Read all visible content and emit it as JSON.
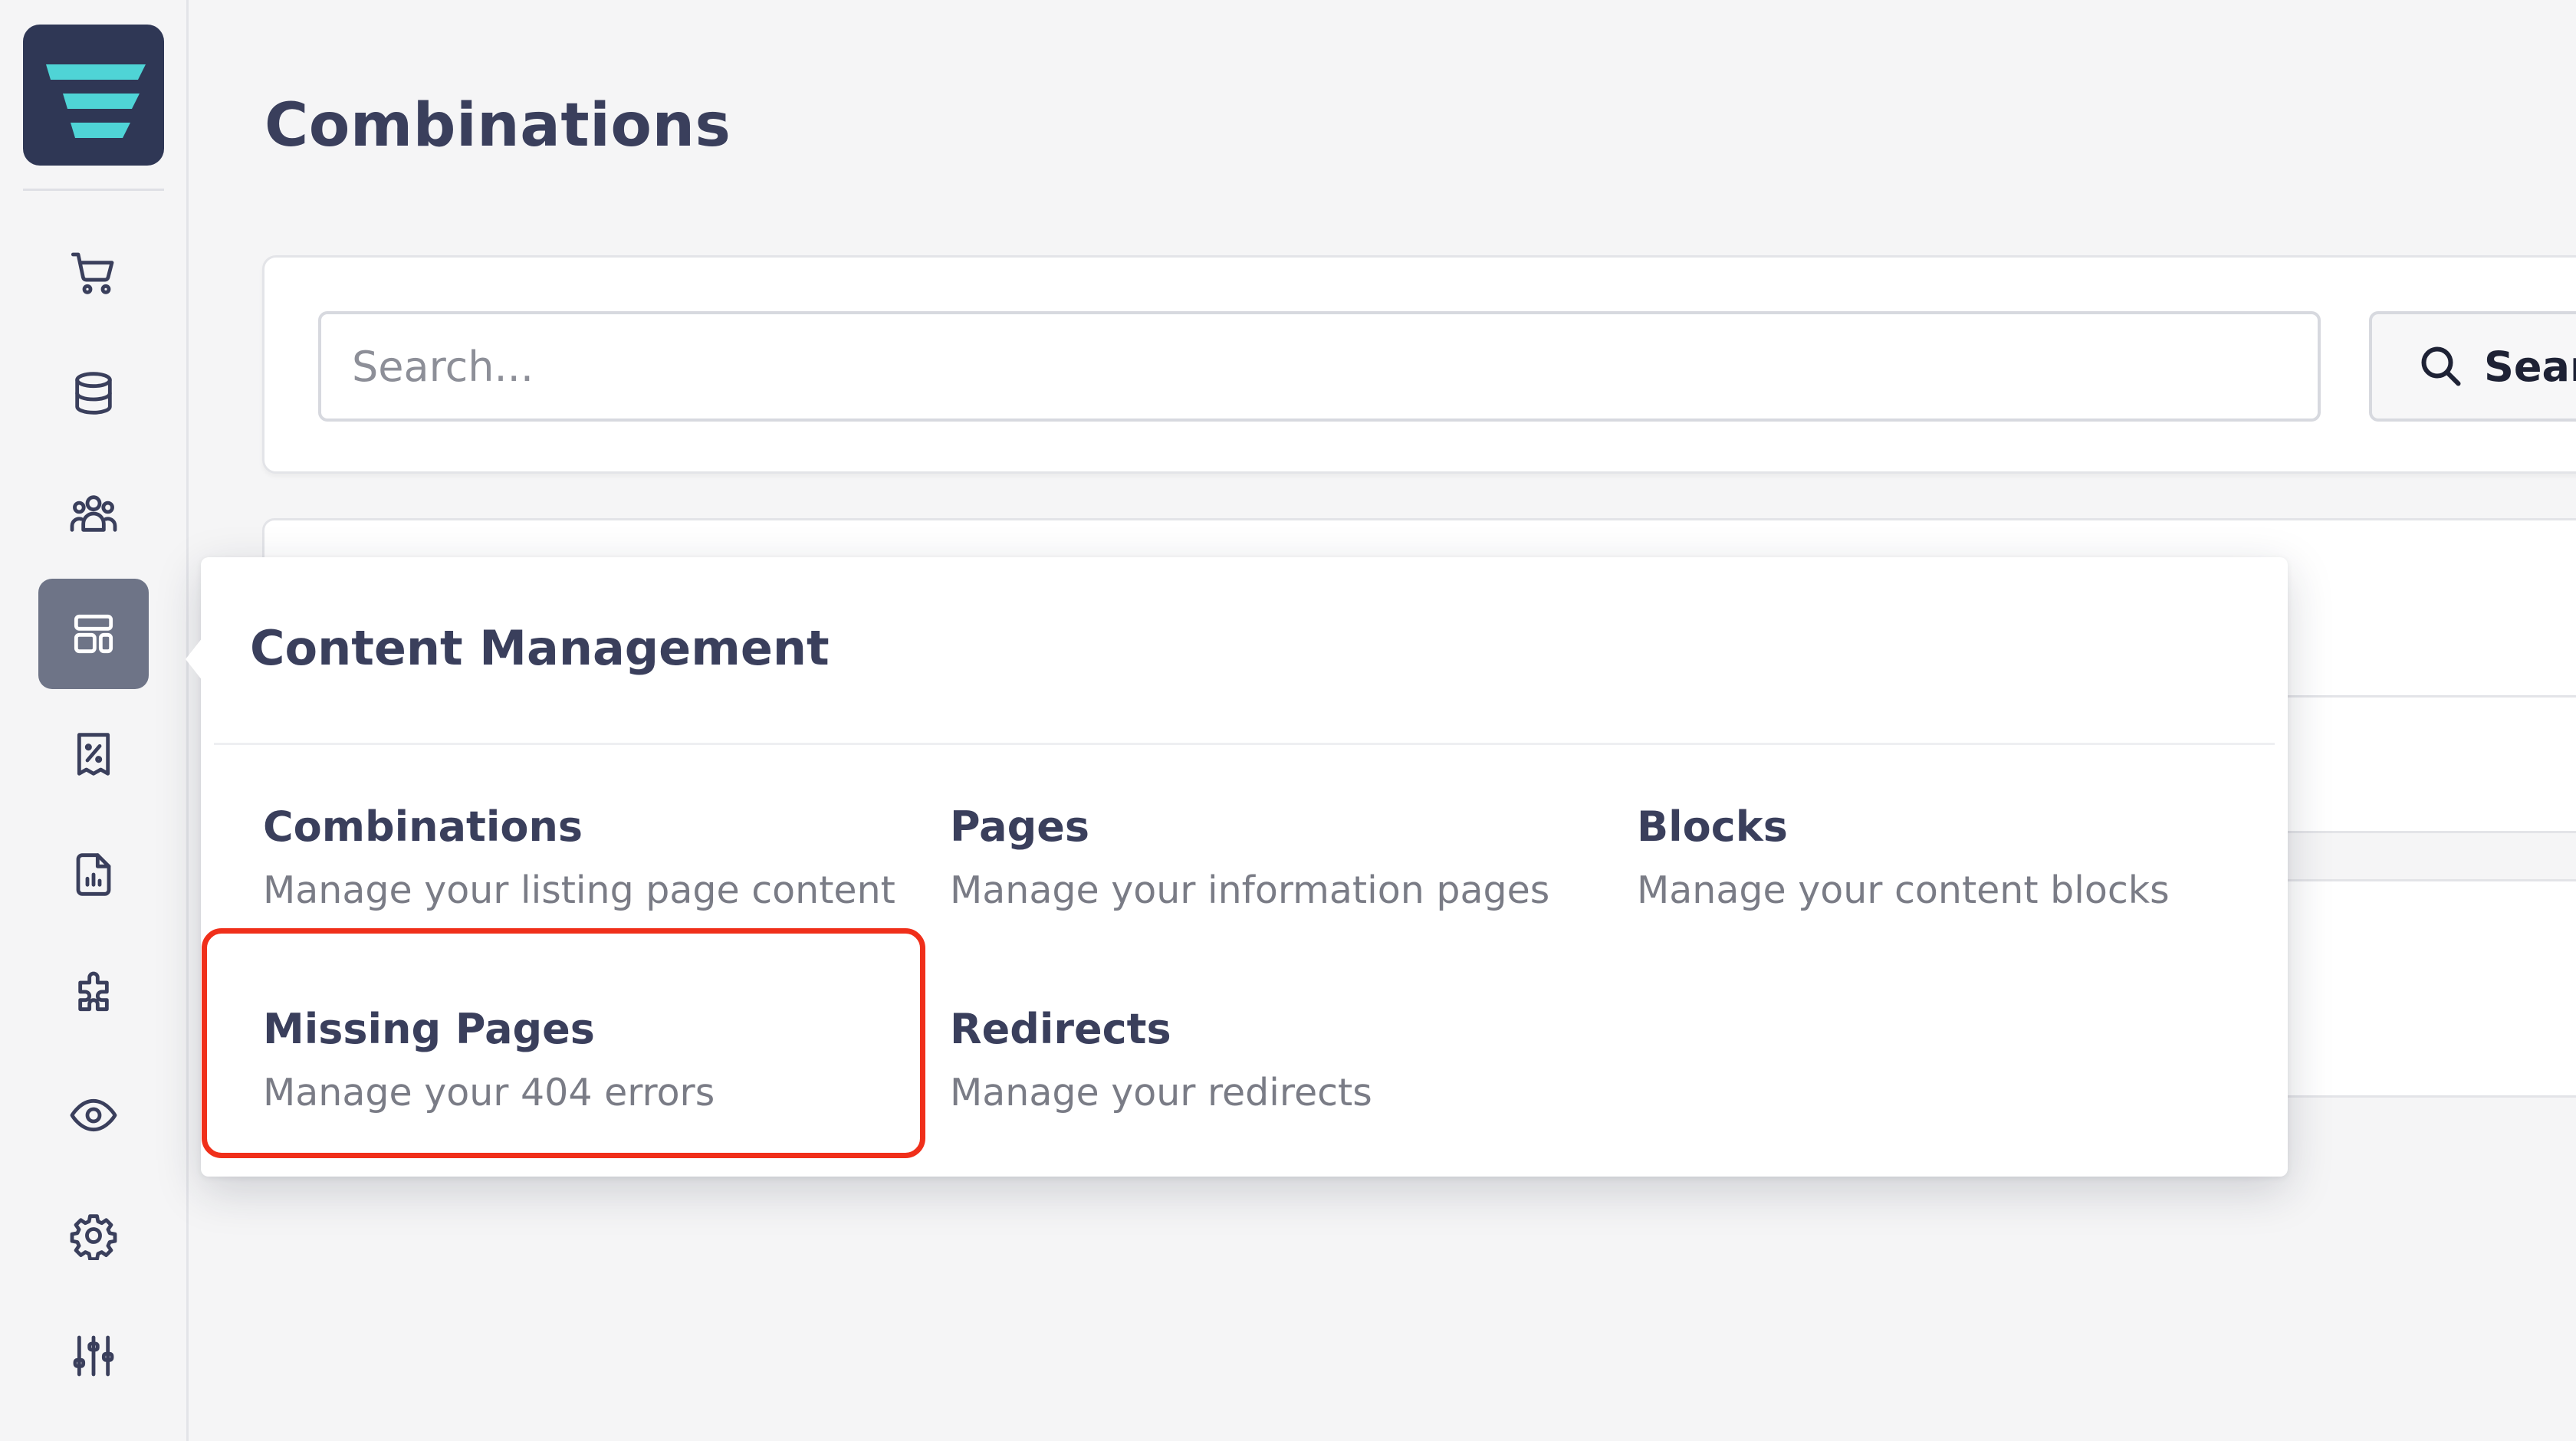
{
  "app": {
    "logo_icon": "brand-logo-icon",
    "accent_color": "#4fd4d6",
    "sidebar_bg_active": "#6e7487"
  },
  "sidebar": {
    "items": [
      {
        "name": "cart-icon",
        "active": false
      },
      {
        "name": "database-icon",
        "active": false
      },
      {
        "name": "users-group-icon",
        "active": false
      },
      {
        "name": "layout-icon",
        "active": true
      },
      {
        "name": "receipt-percent-icon",
        "active": false
      },
      {
        "name": "report-file-icon",
        "active": false
      },
      {
        "name": "puzzle-icon",
        "active": false
      },
      {
        "name": "eye-icon",
        "active": false
      },
      {
        "name": "gear-icon",
        "active": false
      },
      {
        "name": "sliders-icon",
        "active": false
      }
    ]
  },
  "page": {
    "title": "Combinations"
  },
  "search": {
    "placeholder": "Search...",
    "button_label": "Search"
  },
  "popover": {
    "title": "Content Management",
    "items": [
      {
        "title": "Combinations",
        "description": "Manage your listing page content",
        "highlighted": false
      },
      {
        "title": "Pages",
        "description": "Manage your information pages",
        "highlighted": false
      },
      {
        "title": "Blocks",
        "description": "Manage your content blocks",
        "highlighted": false
      },
      {
        "title": "Missing Pages",
        "description": "Manage your 404 errors",
        "highlighted": true
      },
      {
        "title": "Redirects",
        "description": "Manage your redirects",
        "highlighted": false
      }
    ]
  }
}
